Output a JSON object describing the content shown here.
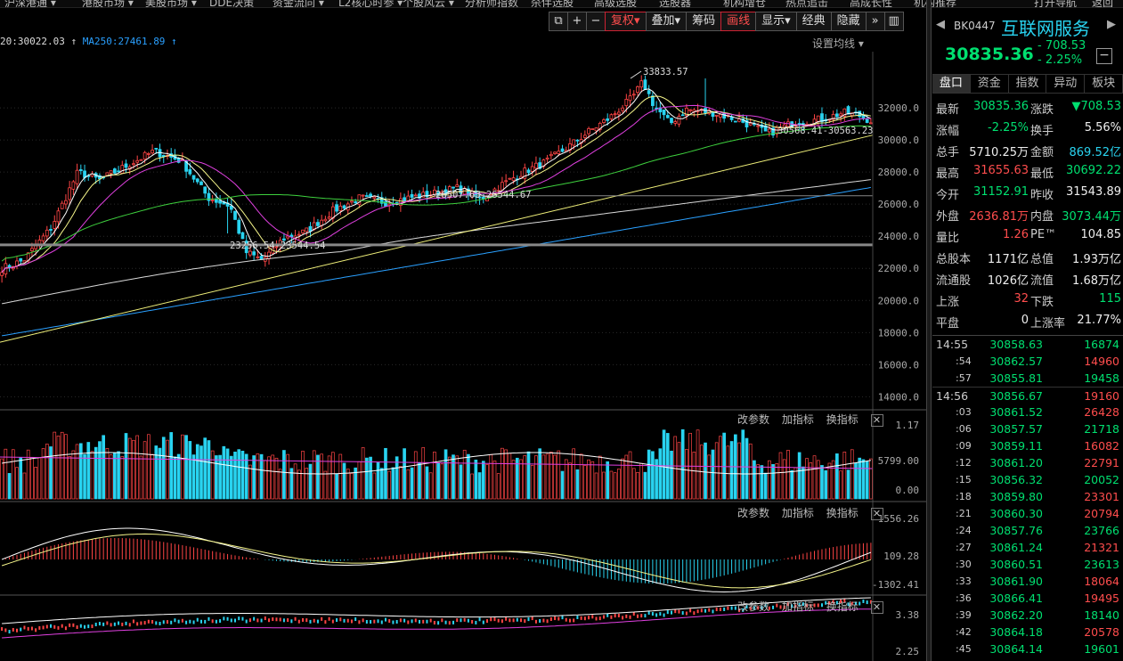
{
  "top_menu": [
    "沪深港通 ▾",
    "港股市场 ▾",
    "美股市场 ▾",
    "DDE决策",
    "资金流向 ▾",
    "L2核心时参 ▾",
    "个股风云 ▾",
    "分析师指数",
    "杀伴选股",
    "高级选股",
    "选股器",
    "机构增仓",
    "热点追击",
    "高成长性",
    "机构推荐",
    "打开导航",
    "返回"
  ],
  "toolbar": {
    "restore_label": "复权▾",
    "overlay_label": "叠加▾",
    "chips_label": "筹码",
    "draw_label": "画线",
    "display_label": "显示▾",
    "classic_label": "经典",
    "hide_label": "隐藏"
  },
  "ma_header": {
    "ma120": "20:30022.03 ↑",
    "ma250": "MA250:27461.89 ↑",
    "settings_label": "设置均线 ▾"
  },
  "sub_pane_header": {
    "params": "改参数",
    "add": "加指标",
    "switch": "换指标",
    "close": "✕"
  },
  "chart_data": [
    {
      "type": "candlestick",
      "title": "",
      "y_ticks": [
        32000,
        30000,
        28000,
        26000,
        24000,
        22000,
        20000,
        18000,
        16000,
        14000
      ],
      "y_tick_labels": [
        "32000.0",
        "30000.0",
        "28000.0",
        "26000.0",
        "24000.0",
        "22000.0",
        "20000.0",
        "18000.0",
        "16000.0",
        "14000.0"
      ],
      "ylim": [
        13300,
        35500
      ],
      "annotations": [
        "33833.57",
        "26507.63-26544.67",
        "23256.54-23544.54",
        "30568.41-30563.23"
      ],
      "colors": {
        "up": "#ff4545",
        "down": "#29d3f0",
        "ma5": "#ffffff",
        "ma10": "#f5f58a",
        "ma20": "#e040e0",
        "ma60": "#3ed13e",
        "ma120": "#d8d8d8",
        "ma250": "#2aa0ff",
        "trend": "#f0f07a"
      }
    },
    {
      "type": "bar",
      "title": "",
      "y_tick_labels": [
        "1.17",
        "5799.00",
        "0.00"
      ]
    },
    {
      "type": "bar",
      "title": "",
      "y_tick_labels": [
        "1556.26",
        "109.28",
        "-1302.41"
      ]
    },
    {
      "type": "line",
      "title": "",
      "y_tick_labels": [
        "3.38",
        "2.25"
      ]
    }
  ],
  "right_panel": {
    "code": "BK0447",
    "name": "互联网服务",
    "price": "30835.36",
    "change": "- 708.53",
    "change_pct": "- 2.25%",
    "minus_btn": "−",
    "tabs": [
      "盘口",
      "资金",
      "指数",
      "异动",
      "板块"
    ],
    "stats": [
      {
        "l1": "最新",
        "v1": "30835.36",
        "c1": "dn",
        "l2": "涨跌",
        "v2": "▼708.53",
        "c2": "dn"
      },
      {
        "l1": "涨幅",
        "v1": "-2.25%",
        "c1": "dn",
        "l2": "换手",
        "v2": "5.56%",
        "c2": "wh"
      },
      {
        "l1": "总手",
        "v1": "5710.25万",
        "c1": "wh",
        "l2": "金额",
        "v2": "869.52亿",
        "c2": "cy"
      },
      {
        "l1": "最高",
        "v1": "31655.63",
        "c1": "up",
        "l2": "最低",
        "v2": "30692.22",
        "c2": "dn"
      },
      {
        "l1": "今开",
        "v1": "31152.91",
        "c1": "dn",
        "l2": "昨收",
        "v2": "31543.89",
        "c2": "wh"
      },
      {
        "l1": "外盘",
        "v1": "2636.81万",
        "c1": "up",
        "l2": "内盘",
        "v2": "3073.44万",
        "c2": "dn"
      },
      {
        "l1": "量比",
        "v1": "1.26",
        "c1": "up",
        "l2": "PE™",
        "v2": "104.85",
        "c2": "wh"
      },
      {
        "l1": "总股本",
        "v1": "1171亿",
        "c1": "wh",
        "l2": "总值",
        "v2": "1.93万亿",
        "c2": "wh"
      },
      {
        "l1": "流通股",
        "v1": "1026亿",
        "c1": "wh",
        "l2": "流值",
        "v2": "1.68万亿",
        "c2": "wh"
      },
      {
        "l1": "上涨",
        "v1": "32",
        "c1": "up",
        "l2": "下跌",
        "v2": "115",
        "c2": "dn"
      },
      {
        "l1": "平盘",
        "v1": "0",
        "c1": "wh",
        "l2": "上涨率",
        "v2": "21.77%",
        "c2": "wh"
      }
    ],
    "ticks": [
      {
        "time": "14:55",
        "price": "30858.63",
        "vol": "16874",
        "c": "dn",
        "sub": false,
        "gap": false
      },
      {
        "time": ":54",
        "price": "30862.57",
        "vol": "14960",
        "c": "up",
        "sub": true,
        "gap": false
      },
      {
        "time": ":57",
        "price": "30855.81",
        "vol": "19458",
        "c": "dn",
        "sub": true,
        "gap": false
      },
      {
        "time": "14:56",
        "price": "30856.67",
        "vol": "19160",
        "c": "up",
        "sub": false,
        "gap": true
      },
      {
        "time": ":03",
        "price": "30861.52",
        "vol": "26428",
        "c": "up",
        "sub": true,
        "gap": false
      },
      {
        "time": ":06",
        "price": "30857.57",
        "vol": "21718",
        "c": "dn",
        "sub": true,
        "gap": false
      },
      {
        "time": ":09",
        "price": "30859.11",
        "vol": "16082",
        "c": "up",
        "sub": true,
        "gap": false
      },
      {
        "time": ":12",
        "price": "30861.20",
        "vol": "22791",
        "c": "up",
        "sub": true,
        "gap": false
      },
      {
        "time": ":15",
        "price": "30856.32",
        "vol": "20052",
        "c": "dn",
        "sub": true,
        "gap": false
      },
      {
        "time": ":18",
        "price": "30859.80",
        "vol": "23301",
        "c": "up",
        "sub": true,
        "gap": false
      },
      {
        "time": ":21",
        "price": "30860.30",
        "vol": "20794",
        "c": "up",
        "sub": true,
        "gap": false
      },
      {
        "time": ":24",
        "price": "30857.76",
        "vol": "23766",
        "c": "dn",
        "sub": true,
        "gap": false
      },
      {
        "time": ":27",
        "price": "30861.24",
        "vol": "21321",
        "c": "up",
        "sub": true,
        "gap": false
      },
      {
        "time": ":30",
        "price": "30860.51",
        "vol": "23613",
        "c": "dn",
        "sub": true,
        "gap": false
      },
      {
        "time": ":33",
        "price": "30861.90",
        "vol": "18064",
        "c": "up",
        "sub": true,
        "gap": false
      },
      {
        "time": ":36",
        "price": "30866.41",
        "vol": "19495",
        "c": "up",
        "sub": true,
        "gap": false
      },
      {
        "time": ":39",
        "price": "30862.20",
        "vol": "18140",
        "c": "dn",
        "sub": true,
        "gap": false
      },
      {
        "time": ":42",
        "price": "30864.18",
        "vol": "20578",
        "c": "up",
        "sub": true,
        "gap": false
      },
      {
        "time": ":45",
        "price": "30864.14",
        "vol": "19601",
        "c": "dn",
        "sub": true,
        "gap": false
      }
    ]
  }
}
